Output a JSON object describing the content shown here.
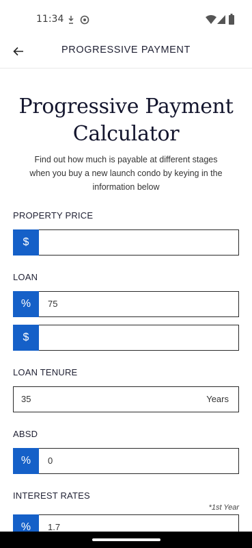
{
  "status": {
    "time": "11:34",
    "icons": [
      "download-icon",
      "settings-icon",
      "wifi-icon",
      "signal-icon",
      "battery-icon"
    ]
  },
  "app_bar": {
    "back_icon": "back-arrow-icon",
    "title": "PROGRESSIVE PAYMENT"
  },
  "header": {
    "title_line1": "Progressive Payment",
    "title_line2": "Calculator",
    "intro": "Find out how much is payable at different stages when you buy a new launch condo by keying in the information below"
  },
  "form": {
    "property_price": {
      "label": "PROPERTY PRICE",
      "prefix": "$",
      "value": ""
    },
    "loan": {
      "label": "LOAN",
      "percent_prefix": "%",
      "percent_value": "75",
      "amount_prefix": "$",
      "amount_value": ""
    },
    "loan_tenure": {
      "label": "LOAN TENURE",
      "value": "35",
      "suffix": "Years"
    },
    "absd": {
      "label": "ABSD",
      "prefix": "%",
      "value": "0"
    },
    "interest_rates": {
      "label": "INTEREST RATES",
      "note": "*1st Year",
      "prefix": "%",
      "value": "1.7"
    }
  },
  "colors": {
    "accent": "#1560c8",
    "text": "#1f2033",
    "border": "#2a2a2a"
  }
}
